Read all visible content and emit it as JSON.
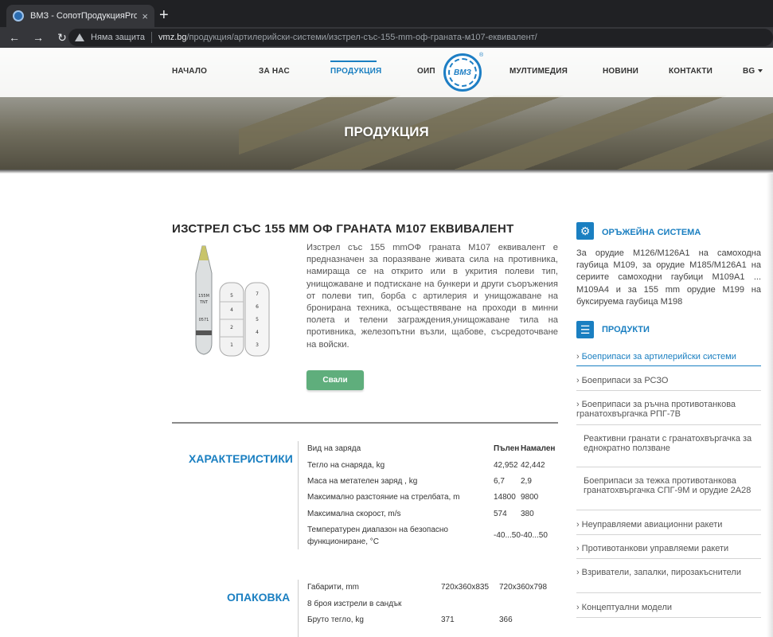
{
  "browser": {
    "tab_title": "ВМЗ - СопотПродукцияProducts",
    "tab_close": "×",
    "new_tab": "+",
    "back": "←",
    "forward": "→",
    "reload": "↻",
    "security_label": "Няма защита",
    "url_host": "vmz.bg",
    "url_path": "/продукция/артилерийски-системи/изстрел-със-155-mm-оф-граната-м107-еквивалент/"
  },
  "nav": {
    "home": "НАЧАЛО",
    "about": "ЗА НАС",
    "products": "ПРОДУКЦИЯ",
    "oip": "ОИП",
    "multimedia": "МУЛТИМЕДИЯ",
    "news": "НОВИНИ",
    "contacts": "КОНТАКТИ",
    "lang": "BG",
    "logo_text": "ВМЗ",
    "logo_reg": "®"
  },
  "hero": {
    "title": "ПРОДУКЦИЯ"
  },
  "product": {
    "title": "ИЗСТРЕЛ СЪС 155 ММ ОФ ГРАНАТА М107 ЕКВИВАЛЕНТ",
    "description": "Изстрел със 155 mmОФ граната М107 еквивалент е предназначен за поразяване живата сила на противника, намираща се на открито или в укрития полеви тип, унищожаване и подтискане на бункери и други съоръжения от полеви тип, борба с артилерия и унищожаване на бронирана техника, осъществяване на проходи в минни полета и телени заграждения,унищожаване тила на противника, железопътни възли, щабове, съсредоточване на войски.",
    "download": "Свали"
  },
  "characteristics": {
    "title": "ХАРАКТЕРИСТИКИ",
    "rows": [
      {
        "label": "Вид на заряда",
        "v1": "Пълен",
        "v2": "Намален"
      },
      {
        "label": "Тегло на снаряда, kg",
        "v1": "42,952",
        "v2": "42,442"
      },
      {
        "label": "Маса на метателен заряд , kg",
        "v1": "6,7",
        "v2": "2,9"
      },
      {
        "label": "Максимално разстояние на стрелбата, m",
        "v1": "14800",
        "v2": "9800"
      },
      {
        "label": "Максимална скорост, m/s",
        "v1": "574",
        "v2": "380"
      },
      {
        "label_l1": "Температурен диапазон на безопасно",
        "label_l2": "функциониране, °C",
        "v1": "-40...50",
        "v2": "-40...50"
      }
    ]
  },
  "packing": {
    "title": "ОПАКОВКА",
    "rows": [
      {
        "label": "Габарити, mm",
        "v1": "720x360x835",
        "v2": "720x360x798"
      },
      {
        "label": "8 броя изстрели в сандък",
        "v1": "",
        "v2": ""
      },
      {
        "label": "Бруто тегло, kg",
        "v1": "371",
        "v2": "366"
      }
    ]
  },
  "sidebar": {
    "weapon_title": "ОРЪЖЕЙНА СИСТЕМА",
    "weapon_text": "За орудие М126/М126А1 на самоходна гаубица М109, за орудие М185/М126А1 на сериите самоходни гаубици М109А1 ... М109А4 и за 155 mm орудие М199 на буксируема гаубица М198",
    "products_title": "ПРОДУКТИ",
    "items": [
      "Боеприпаси за артилерийски системи",
      "Боеприпаси за РСЗО",
      "Боеприпаси за ръчна противотанкова гранатохвъргачка РПГ-7В",
      "Реактивни гранати с гранатохвъргачка за еднократно ползване",
      "Боеприпаси за тежка противотанкова гранатохвъргачка СПГ-9М и орудие 2А28",
      "Неуправляеми авиационни ракети",
      "Противотанкови управляеми ракети",
      "Взриватели, запалки, пирозакъснители",
      "Концептуални модели"
    ]
  },
  "colors": {
    "accent": "#1a7fc1",
    "button": "#5fae7c"
  },
  "icons": {
    "weapon": "gears-icon",
    "products": "list-icon",
    "security": "warning-icon"
  }
}
